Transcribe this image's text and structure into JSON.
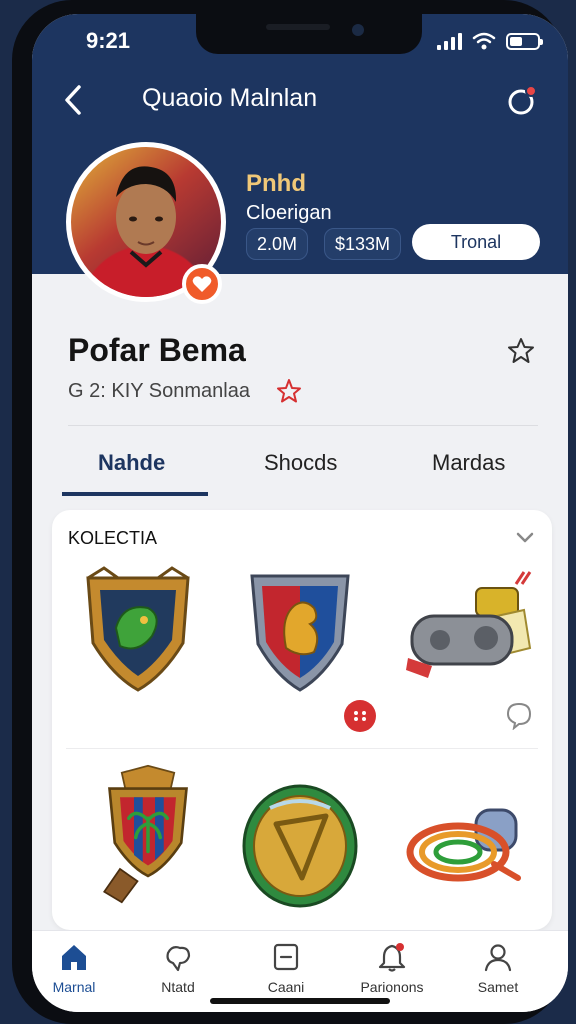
{
  "status_bar": {
    "time": "9:21"
  },
  "header": {
    "title": "Quaoio Malnlan",
    "profile": {
      "name": "Pnhd",
      "subtitle": "Cloerigan",
      "stats": [
        "2.0M",
        "$133M"
      ],
      "follow_label": "Tronal"
    }
  },
  "profile": {
    "name": "Pofar Bema",
    "meta": "G 2: KIY Sonmanlaa"
  },
  "tabs": [
    {
      "label": "Nahde",
      "active": true
    },
    {
      "label": "Shocds",
      "active": false
    },
    {
      "label": "Mardas",
      "active": false
    }
  ],
  "collection": {
    "title": "KOLECTIA",
    "items": [
      "shield-dragon",
      "shield-lion",
      "gamepad-gear",
      "shield-palm",
      "shield-gold",
      "rope-tool"
    ]
  },
  "bottom_nav": [
    {
      "label": "Marnal",
      "icon": "home-icon",
      "active": true
    },
    {
      "label": "Ntatd",
      "icon": "map-icon",
      "active": false
    },
    {
      "label": "Caani",
      "icon": "square-icon",
      "active": false
    },
    {
      "label": "Parionons",
      "icon": "bell-icon",
      "active": false
    },
    {
      "label": "Samet",
      "icon": "person-icon",
      "active": false
    }
  ],
  "colors": {
    "header_bg": "#1d3560",
    "accent_gold": "#f0c878",
    "badge_orange": "#f05b2a",
    "notify_red": "#d63031"
  }
}
